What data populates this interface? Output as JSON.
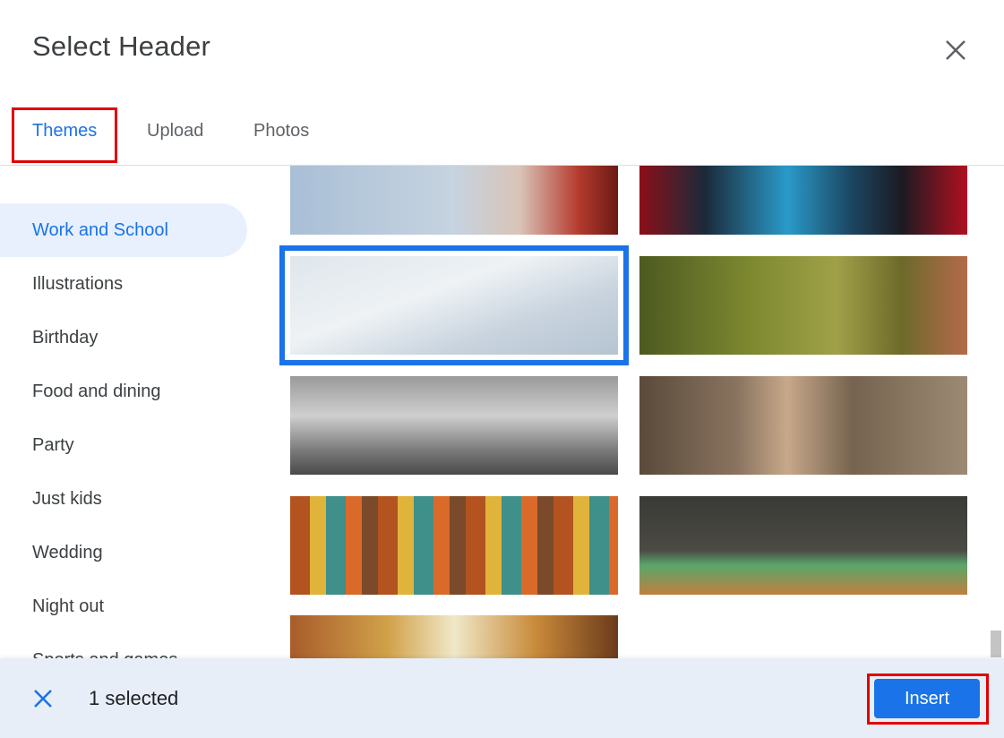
{
  "dialog": {
    "title": "Select Header"
  },
  "tabs": [
    {
      "label": "Themes",
      "active": true
    },
    {
      "label": "Upload",
      "active": false
    },
    {
      "label": "Photos",
      "active": false
    }
  ],
  "sidebar": {
    "items": [
      {
        "label": "Work and School",
        "active": true
      },
      {
        "label": "Illustrations"
      },
      {
        "label": "Birthday"
      },
      {
        "label": "Food and dining"
      },
      {
        "label": "Party"
      },
      {
        "label": "Just kids"
      },
      {
        "label": "Wedding"
      },
      {
        "label": "Night out"
      },
      {
        "label": "Sports and games"
      }
    ]
  },
  "themes": [
    {
      "name": "flower-petal-theme"
    },
    {
      "name": "butterfly-theme"
    },
    {
      "name": "mannequins-theme",
      "selected": true
    },
    {
      "name": "runner-grass-theme"
    },
    {
      "name": "open-book-quill-theme"
    },
    {
      "name": "dry-leaves-wood-theme"
    },
    {
      "name": "bookshelf-illustration-theme"
    },
    {
      "name": "chemistry-lab-theme"
    },
    {
      "name": "desk-coffee-theme"
    }
  ],
  "footer": {
    "selected_count": "1 selected",
    "insert_label": "Insert"
  },
  "colors": {
    "accent": "#1a73e8",
    "highlight": "#e00000"
  }
}
